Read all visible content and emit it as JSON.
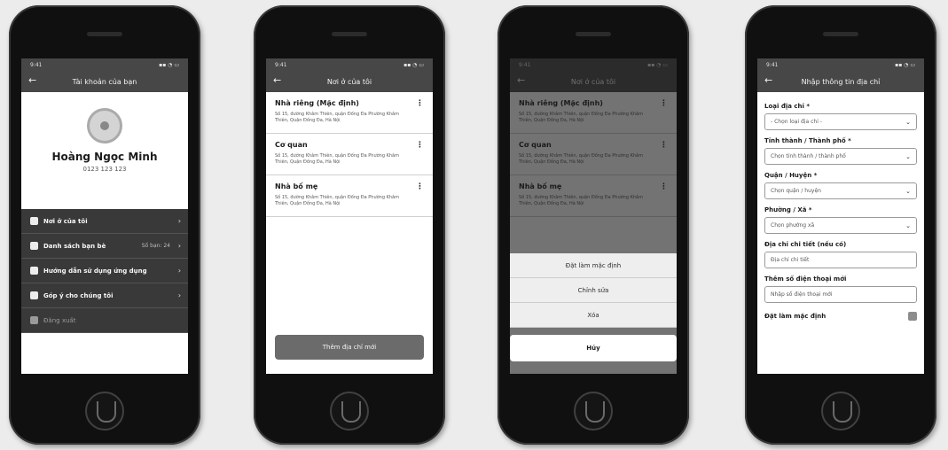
{
  "status": {
    "left": "9:41",
    "right": "▪▪ ◔ ▭"
  },
  "screen1": {
    "title": "Tài khoản của bạn",
    "name": "Hoàng Ngọc Minh",
    "phone": "0123 123 123",
    "menu": [
      {
        "label": "Nơi ở của tôi",
        "count": ""
      },
      {
        "label": "Danh sách bạn bè",
        "count": "Số bạn: 24"
      },
      {
        "label": "Hướng dẫn sử dụng ứng dụng",
        "count": ""
      },
      {
        "label": "Góp ý cho chúng tôi",
        "count": ""
      }
    ],
    "logout": "Đăng xuất"
  },
  "screen2": {
    "title": "Nơi ở của tôi",
    "addresses": [
      {
        "name": "Nhà riêng (Mặc định)",
        "detail": "Số 15, đường Khâm Thiên, quận Đống Đa Phường Khâm Thiên, Quận Đống Đa, Hà Nội"
      },
      {
        "name": "Cơ quan",
        "detail": "Số 15, đường Khâm Thiên, quận Đống Đa Phường Khâm Thiên, Quận Đống Đa, Hà Nội"
      },
      {
        "name": "Nhà bố mẹ",
        "detail": "Số 15, đường Khâm Thiên, quận Đống Đa Phường Khâm Thiên, Quận Đống Đa, Hà Nội"
      }
    ],
    "add_button": "Thêm địa chỉ mới"
  },
  "screen3": {
    "options": [
      "Đặt làm mặc định",
      "Chỉnh sửa",
      "Xóa"
    ],
    "cancel": "Hủy"
  },
  "screen4": {
    "title": "Nhập thông tin địa chỉ",
    "type_label": "Loại địa chỉ *",
    "type_value": "- Chọn loại địa chỉ -",
    "city_label": "Tỉnh thành / Thành phố *",
    "city_value": "Chọn tỉnh thành / thành phố",
    "district_label": "Quận / Huyện *",
    "district_value": "Chọn quận / huyện",
    "ward_label": "Phường / Xã *",
    "ward_value": "Chọn phường xã",
    "detail_label": "Địa chỉ chi tiết (nếu có)",
    "detail_placeholder": "Địa chỉ chi tiết",
    "extra_phone_label": "Thêm số điện thoại mới",
    "extra_phone_placeholder": "Nhập số điện thoại mới",
    "default_label": "Đặt làm mặc định"
  }
}
